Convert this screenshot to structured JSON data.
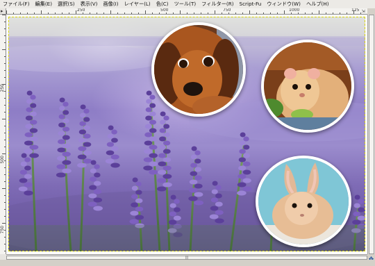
{
  "menubar": {
    "items": [
      "ファイル(F)",
      "編集(E)",
      "選択(S)",
      "表示(V)",
      "画像(I)",
      "レイヤー(L)",
      "色(C)",
      "ツール(T)",
      "フィルター(R)",
      "Script-Fu",
      "ウィンドウ(W)",
      "ヘルプ(H)"
    ]
  },
  "ruler": {
    "h_labels": [
      "250",
      "500",
      "750",
      "1000",
      "125"
    ],
    "v_labels": [
      "250",
      "500",
      "750"
    ]
  },
  "scrollbar": {
    "h_thumb": "|||"
  },
  "icons": {
    "corner": "corner-arrow-icon",
    "navigate": "navigate-cross-icon",
    "nav_button": "ruler-nav-icon"
  },
  "colors": {
    "selection_border": "#d8d400",
    "lavender": "#8e7dc6",
    "accent": "#1a4d9a"
  },
  "symbols": {
    "corner_arrow": "▸",
    "navigate": "✥",
    "nav_button": "⇲"
  }
}
